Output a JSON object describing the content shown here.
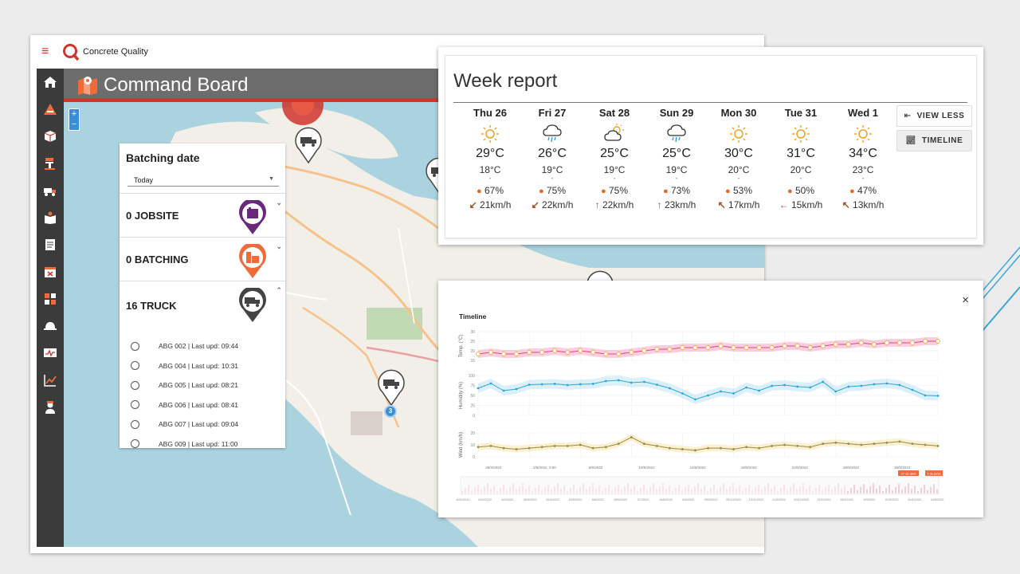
{
  "app": {
    "name": "Concrete Quality",
    "board_title": "Command Board"
  },
  "sidebar": {
    "items": [
      "home-icon",
      "construction-icon",
      "box-icon",
      "conveyor-icon",
      "truck-icon",
      "book-pin-icon",
      "document-icon",
      "calendar-icon",
      "calculator-icon",
      "hardhat-icon",
      "monitor-icon",
      "chart-icon",
      "worker-icon"
    ]
  },
  "map": {
    "zoom_in": "+",
    "zoom_out": "−",
    "cluster_count": "3"
  },
  "filter": {
    "title": "Batching date",
    "date_value": "Today",
    "categories": [
      {
        "label": "0 JOBSITE",
        "color": "#6a2a7a",
        "icon": "jobsite-pin-icon"
      },
      {
        "label": "0 BATCHING",
        "color": "#ef6c3a",
        "icon": "batching-pin-icon"
      },
      {
        "label": "16 TRUCK",
        "color": "#444444",
        "icon": "truck-pin-icon"
      }
    ],
    "trucks": [
      "ABG 002 | Last upd: 09:44",
      "ABG 004 | Last upd: 10:31",
      "ABG 005 | Last upd: 08:21",
      "ABG 006 | Last upd: 08:41",
      "ABG 007 | Last upd: 09:04",
      "ABG 009 | Last upd: 11:00"
    ]
  },
  "week_report": {
    "title": "Week report",
    "view_less": "VIEW LESS",
    "timeline_button": "TIMELINE",
    "days": [
      {
        "day": "Thu 26",
        "icon": "sunny-icon",
        "max": "29°C",
        "min": "18°C",
        "humidity": "67%",
        "wind": "21km/h",
        "wind_arrow": "↙"
      },
      {
        "day": "Fri 27",
        "icon": "rain-icon",
        "max": "26°C",
        "min": "19°C",
        "humidity": "75%",
        "wind": "22km/h",
        "wind_arrow": "↙"
      },
      {
        "day": "Sat 28",
        "icon": "partly-cloudy-icon",
        "max": "25°C",
        "min": "19°C",
        "humidity": "75%",
        "wind": "22km/h",
        "wind_arrow": "↑"
      },
      {
        "day": "Sun 29",
        "icon": "rain-icon",
        "max": "25°C",
        "min": "19°C",
        "humidity": "73%",
        "wind": "23km/h",
        "wind_arrow": "↑"
      },
      {
        "day": "Mon 30",
        "icon": "sunny-icon",
        "max": "30°C",
        "min": "20°C",
        "humidity": "53%",
        "wind": "17km/h",
        "wind_arrow": "↖"
      },
      {
        "day": "Tue 31",
        "icon": "sunny-icon",
        "max": "31°C",
        "min": "20°C",
        "humidity": "50%",
        "wind": "15km/h",
        "wind_arrow": "←"
      },
      {
        "day": "Wed 1",
        "icon": "sunny-icon",
        "max": "34°C",
        "min": "23°C",
        "humidity": "47%",
        "wind": "13km/h",
        "wind_arrow": "↖"
      }
    ]
  },
  "timeline": {
    "title": "Timeline",
    "close": "×",
    "axes": {
      "temp": "Temp. (°C)",
      "humidity": "Humidity (%)",
      "wind": "Wind (km/h)"
    },
    "temp_ticks": [
      "30",
      "25",
      "20",
      "15"
    ],
    "hum_ticks": [
      "100",
      "75",
      "50",
      "25",
      "0"
    ],
    "wind_ticks": [
      "20",
      "10",
      "0"
    ],
    "temp_series": [
      18,
      19,
      18,
      18,
      19,
      19,
      20,
      19,
      20,
      19,
      18,
      18,
      19,
      20,
      21,
      21,
      22,
      22,
      22,
      23,
      22,
      22,
      22,
      22,
      23,
      23,
      22,
      23,
      24,
      24,
      25,
      24,
      25,
      25,
      25,
      26,
      26
    ],
    "hum_series": [
      68,
      80,
      62,
      66,
      77,
      78,
      79,
      76,
      78,
      79,
      86,
      88,
      82,
      84,
      77,
      68,
      55,
      40,
      50,
      60,
      55,
      70,
      62,
      74,
      76,
      72,
      70,
      84,
      60,
      72,
      74,
      78,
      80,
      76,
      64,
      50,
      49
    ],
    "wind_series": [
      9,
      10,
      8,
      7,
      8,
      9,
      10,
      10,
      11,
      8,
      9,
      12,
      18,
      12,
      10,
      8,
      7,
      6,
      8,
      8,
      7,
      9,
      8,
      10,
      11,
      10,
      9,
      12,
      13,
      12,
      11,
      12,
      13,
      14,
      12,
      11,
      10
    ],
    "x_dates": [
      "28/4/2022",
      "2/5/2022, 0:00",
      "6/5/2022",
      "10/5/2022",
      "14/5/2022",
      "18/5/2022",
      "22/5/2022",
      "26/5/2022",
      "30/5/2022"
    ],
    "nav_dates": [
      "16/11/2021",
      "10/2/2022",
      "6/3/2022",
      "26/3/2022",
      "20/4/2022",
      "15/5/2022",
      "6/6/2022",
      "28/6/2022",
      "2/7/2022",
      "15/8/2022",
      "6/9/2022",
      "25/9/2022",
      "20/10/2022",
      "12/11/2022",
      "1/12/2022",
      "20/12/2022",
      "21/1/2022",
      "15/2/2022",
      "9/3/2022",
      "21/3/2022",
      "20/4/2022",
      "14/5/2022"
    ],
    "nav_marker_1": "27 de abril",
    "nav_marker_2": "1 de junio"
  }
}
